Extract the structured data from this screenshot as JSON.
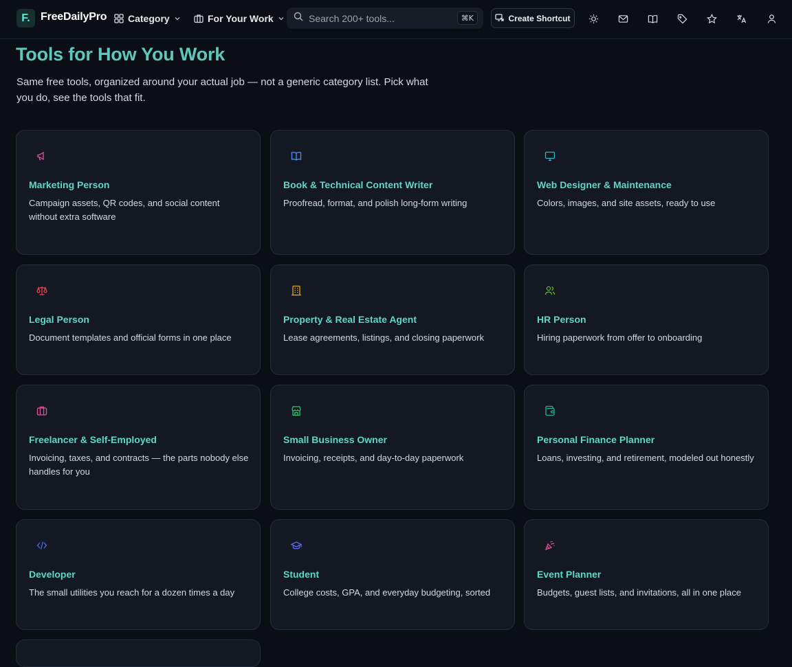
{
  "header": {
    "logo_letter": "F.",
    "brand": "FreeDailyPro",
    "nav": [
      {
        "label": "Category",
        "icon": "grid-icon"
      },
      {
        "label": "For Your Work",
        "icon": "briefcase-icon"
      }
    ],
    "search": {
      "placeholder": "Search 200+ tools...",
      "shortcut": "⌘K"
    },
    "shortcut_button": "Create Shortcut",
    "icons": [
      "sun-icon",
      "mail-icon",
      "book-icon",
      "tag-icon",
      "star-icon",
      "translate-icon",
      "user-icon"
    ]
  },
  "hero": {
    "title": "Tools for How You Work",
    "subtitle": "Same free tools, organized around your actual job — not a generic category list. Pick what you do, see the tools that fit."
  },
  "colors": {
    "accent": "#5fd7c6",
    "background": "#0b0e14",
    "card": "#131823"
  },
  "cards": [
    {
      "title": "Marketing Person",
      "desc": "Campaign assets, QR codes, and social content without extra software",
      "icon": "megaphone-icon",
      "icon_color": "#e0529c"
    },
    {
      "title": "Book & Technical Content Writer",
      "desc": "Proofread, format, and polish long-form writing",
      "icon": "book-open-icon",
      "icon_color": "#4f8ff7"
    },
    {
      "title": "Web Designer & Maintenance",
      "desc": "Colors, images, and site assets, ready to use",
      "icon": "monitor-icon",
      "icon_color": "#2bb6c6"
    },
    {
      "title": "Legal Person",
      "desc": "Document templates and official forms in one place",
      "icon": "scale-icon",
      "icon_color": "#ef4444"
    },
    {
      "title": "Property & Real Estate Agent",
      "desc": "Lease agreements, listings, and closing paperwork",
      "icon": "building-icon",
      "icon_color": "#e0a21a"
    },
    {
      "title": "HR Person",
      "desc": "Hiring paperwork from offer to onboarding",
      "icon": "users-icon",
      "icon_color": "#65b33a"
    },
    {
      "title": "Freelancer & Self-Employed",
      "desc": "Invoicing, taxes, and contracts — the parts nobody else handles for you",
      "icon": "briefcase-icon",
      "icon_color": "#e0529c"
    },
    {
      "title": "Small Business Owner",
      "desc": "Invoicing, receipts, and day-to-day paperwork",
      "icon": "store-icon",
      "icon_color": "#34c46a"
    },
    {
      "title": "Personal Finance Planner",
      "desc": "Loans, investing, and retirement, modeled out honestly",
      "icon": "wallet-icon",
      "icon_color": "#22b38a"
    },
    {
      "title": "Developer",
      "desc": "The small utilities you reach for a dozen times a day",
      "icon": "code-icon",
      "icon_color": "#4f6df5"
    },
    {
      "title": "Student",
      "desc": "College costs, GPA, and everyday budgeting, sorted",
      "icon": "graduation-cap-icon",
      "icon_color": "#6366f1"
    },
    {
      "title": "Event Planner",
      "desc": "Budgets, guest lists, and invitations, all in one place",
      "icon": "party-popper-icon",
      "icon_color": "#ec4899"
    }
  ]
}
